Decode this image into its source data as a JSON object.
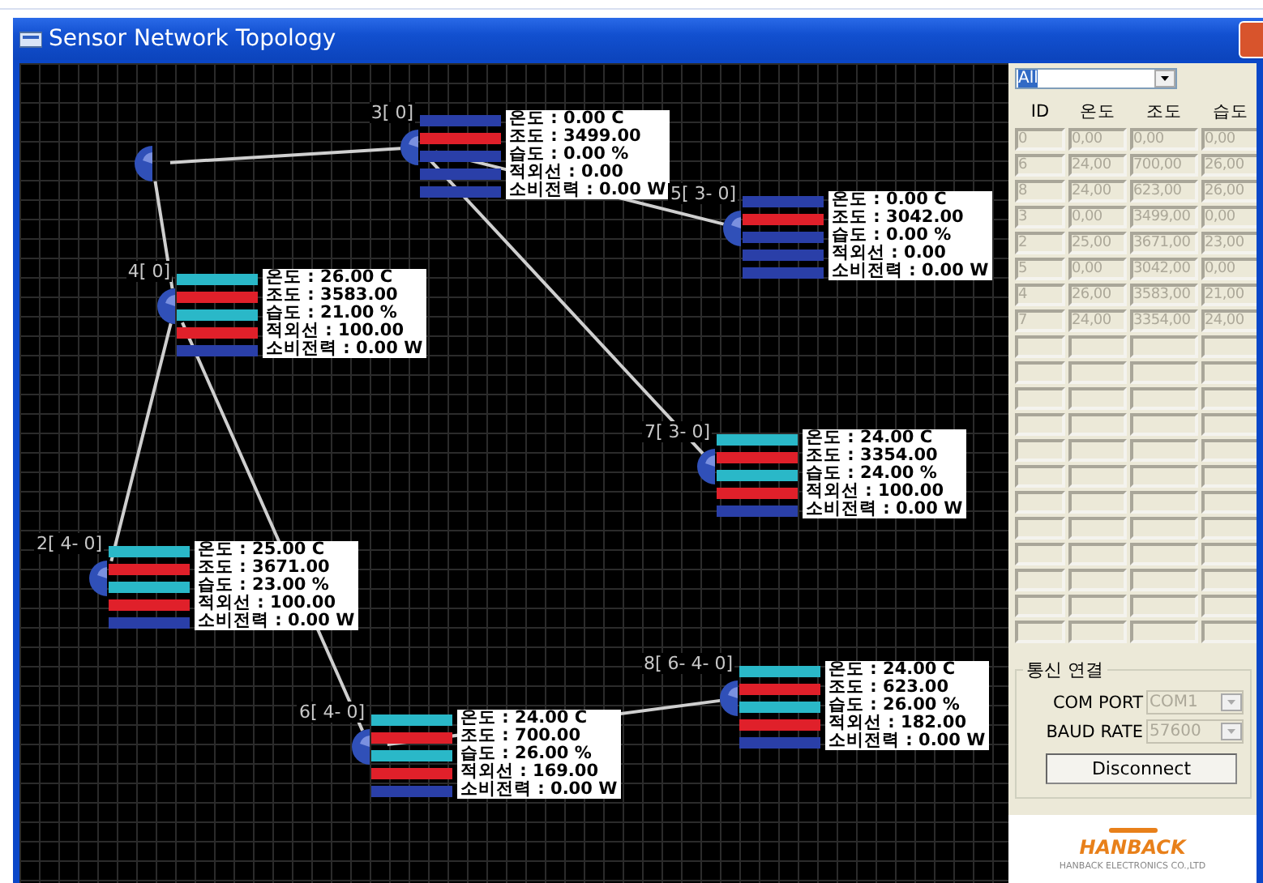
{
  "window": {
    "title": "Sensor Network Topology"
  },
  "nodes": [
    {
      "kind": "sink"
    },
    {
      "kind": "sensor",
      "label": "3[ 0]",
      "readings": [
        {
          "text": "온도 : 0.00 C",
          "color": "#2a3fa8"
        },
        {
          "text": "조도 : 3499.00",
          "color": "#e0202a"
        },
        {
          "text": "습도 : 0.00 %",
          "color": "#2a3fa8"
        },
        {
          "text": "적외선 : 0.00",
          "color": "#2a3fa8"
        },
        {
          "text": "소비전력 : 0.00 W",
          "color": "#2a3fa8"
        }
      ]
    },
    {
      "kind": "sensor",
      "label": "5[ 3- 0]",
      "readings": [
        {
          "text": "온도 : 0.00 C",
          "color": "#2a3fa8"
        },
        {
          "text": "조도 : 3042.00",
          "color": "#e0202a"
        },
        {
          "text": "습도 : 0.00 %",
          "color": "#2a3fa8"
        },
        {
          "text": "적외선 : 0.00",
          "color": "#2a3fa8"
        },
        {
          "text": "소비전력 : 0.00 W",
          "color": "#2a3fa8"
        }
      ]
    },
    {
      "kind": "sensor",
      "label": "4[ 0]",
      "readings": [
        {
          "text": "온도 : 26.00 C",
          "color": "#2ab8c8"
        },
        {
          "text": "조도 : 3583.00",
          "color": "#e0202a"
        },
        {
          "text": "습도 : 21.00 %",
          "color": "#2ab8c8"
        },
        {
          "text": "적외선 : 100.00",
          "color": "#e0202a"
        },
        {
          "text": "소비전력 : 0.00 W",
          "color": "#2a3fa8"
        }
      ]
    },
    {
      "kind": "sensor",
      "label": "7[ 3- 0]",
      "readings": [
        {
          "text": "온도 : 24.00 C",
          "color": "#2ab8c8"
        },
        {
          "text": "조도 : 3354.00",
          "color": "#e0202a"
        },
        {
          "text": "습도 : 24.00 %",
          "color": "#2ab8c8"
        },
        {
          "text": "적외선 : 100.00",
          "color": "#e0202a"
        },
        {
          "text": "소비전력 : 0.00 W",
          "color": "#2a3fa8"
        }
      ]
    },
    {
      "kind": "sensor",
      "label": "2[ 4- 0]",
      "readings": [
        {
          "text": "온도 : 25.00 C",
          "color": "#2ab8c8"
        },
        {
          "text": "조도 : 3671.00",
          "color": "#e0202a"
        },
        {
          "text": "습도 : 23.00 %",
          "color": "#2ab8c8"
        },
        {
          "text": "적외선 : 100.00",
          "color": "#e0202a"
        },
        {
          "text": "소비전력 : 0.00 W",
          "color": "#2a3fa8"
        }
      ]
    },
    {
      "kind": "sensor",
      "label": "6[ 4- 0]",
      "readings": [
        {
          "text": "온도 : 24.00 C",
          "color": "#2ab8c8"
        },
        {
          "text": "조도 : 700.00",
          "color": "#e0202a"
        },
        {
          "text": "습도 : 26.00 %",
          "color": "#2ab8c8"
        },
        {
          "text": "적외선 : 169.00",
          "color": "#e0202a"
        },
        {
          "text": "소비전력 : 0.00 W",
          "color": "#2a3fa8"
        }
      ]
    },
    {
      "kind": "sensor",
      "label": "8[ 6- 4- 0]",
      "readings": [
        {
          "text": "온도 : 24.00 C",
          "color": "#2ab8c8"
        },
        {
          "text": "조도 : 623.00",
          "color": "#e0202a"
        },
        {
          "text": "습도 : 26.00 %",
          "color": "#2ab8c8"
        },
        {
          "text": "적외선 : 182.00",
          "color": "#e0202a"
        },
        {
          "text": "소비전력 : 0.00 W",
          "color": "#2a3fa8"
        }
      ]
    }
  ],
  "filter": {
    "value": "All"
  },
  "table": {
    "columns": [
      "ID",
      "온도",
      "조도",
      "습도"
    ],
    "rows": [
      [
        "0",
        "0,00",
        "0,00",
        "0,00"
      ],
      [
        "6",
        "24,00",
        "700,00",
        "26,00"
      ],
      [
        "8",
        "24,00",
        "623,00",
        "26,00"
      ],
      [
        "3",
        "0,00",
        "3499,00",
        "0,00"
      ],
      [
        "2",
        "25,00",
        "3671,00",
        "23,00"
      ],
      [
        "5",
        "0,00",
        "3042,00",
        "0,00"
      ],
      [
        "4",
        "26,00",
        "3583,00",
        "21,00"
      ],
      [
        "7",
        "24,00",
        "3354,00",
        "24,00"
      ]
    ]
  },
  "connection": {
    "title": "통신 연결",
    "fields": [
      {
        "label": "COM PORT",
        "value": "COM1",
        "disabled": true
      },
      {
        "label": "BAUD RATE",
        "value": "57600",
        "disabled": true
      }
    ],
    "button": "Disconnect"
  },
  "logo": {
    "name": "HANBACK",
    "tagline": "HANBACK ELECTRONICS CO.,LTD"
  }
}
